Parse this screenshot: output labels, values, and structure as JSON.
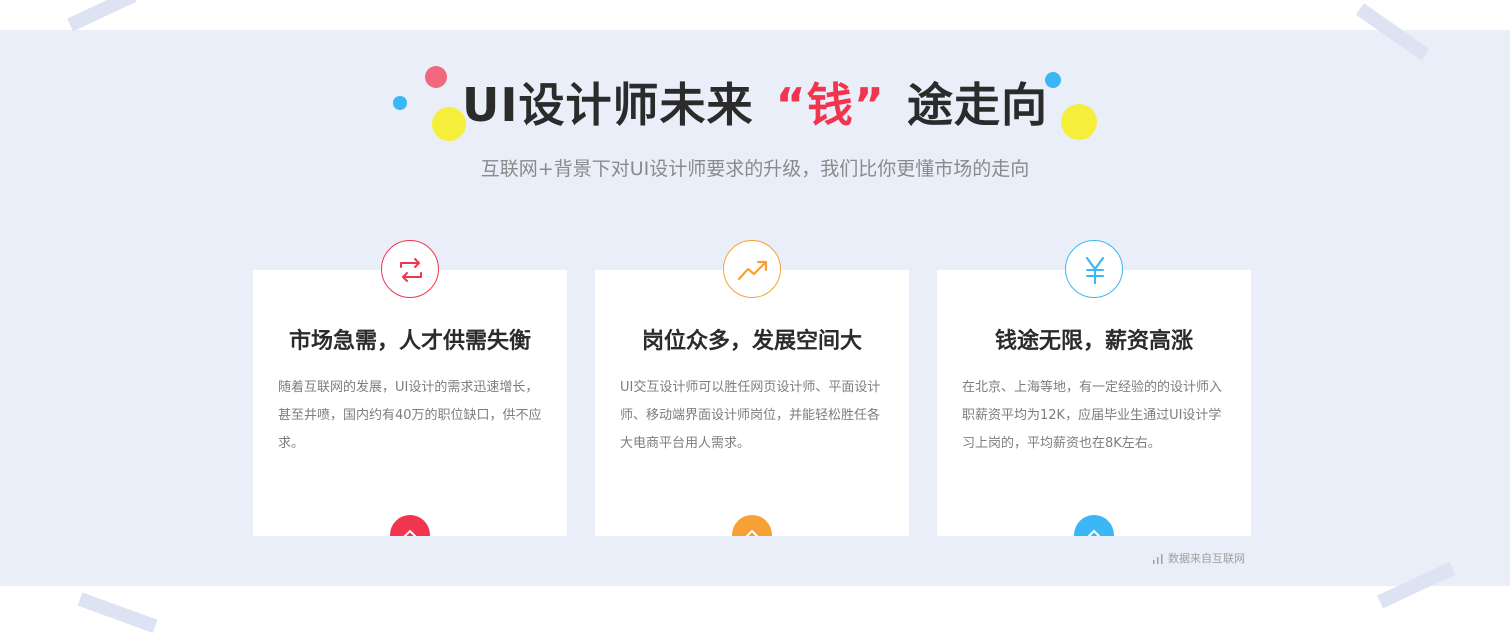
{
  "header": {
    "title_pre": "UI设计师未来",
    "title_highlight": "“钱”",
    "title_post": "途走向",
    "subtitle": "互联网+背景下对UI设计师要求的升级，我们比你更懂市场的走向"
  },
  "cards": [
    {
      "icon": "exchange-arrows-icon",
      "accent": "#f0354f",
      "title": "市场急需，人才供需失衡",
      "text": "随着互联网的发展，UI设计的需求迅速增长，甚至井喷，国内约有40万的职位缺口，供不应求。"
    },
    {
      "icon": "trend-up-icon",
      "accent": "#f7a035",
      "title": "岗位众多，发展空间大",
      "text": "UI交互设计师可以胜任网页设计师、平面设计师、移动端界面设计师岗位，并能轻松胜任各大电商平台用人需求。"
    },
    {
      "icon": "yen-icon",
      "accent": "#3bb7f5",
      "title": "钱途无限，薪资高涨",
      "text": "在北京、上海等地，有一定经验的的设计师入职薪资平均为12K，应届毕业生通过UI设计学习上岗的，平均薪资也在8K左右。"
    }
  ],
  "footer": {
    "source_icon": "bar-chart-icon",
    "source": "数据来自互联网"
  },
  "colors": {
    "band": "#eaeef8",
    "red": "#f0354f",
    "orange": "#f7a035",
    "blue": "#3bb7f5",
    "yellow": "#f5ee3a"
  }
}
